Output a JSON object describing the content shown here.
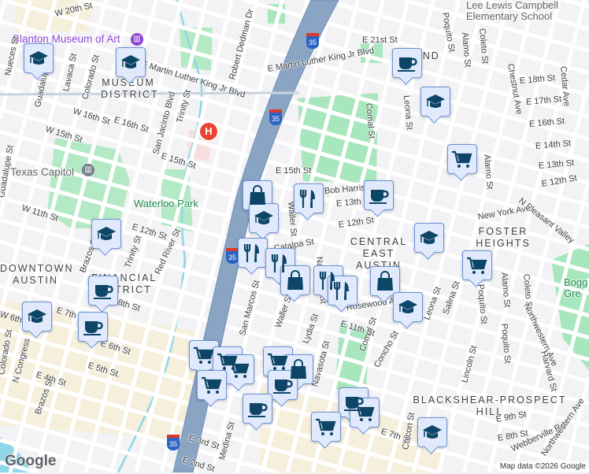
{
  "map": {
    "colors": {
      "background": "#f3f2f4",
      "road": "#ffffff",
      "road_edge": "#d3d9e0",
      "park": "#a8e6bd",
      "highway": "#8aa4c4",
      "water": "#8fd6e8",
      "marker_bg": "#e0eafc",
      "marker_border": "#6b93d6",
      "marker_icon": "#0d4566"
    },
    "pois": {
      "museum": "Blanton Museum of Art",
      "capitol": "Texas Capitol",
      "school": "Lee Lewis Campbell Elementary School",
      "park": "Waterloo Park",
      "boggy": "Bogg Gre",
      "hospital": "H"
    },
    "districts": {
      "museum": "MUSEUM DISTRICT",
      "downtown": "DOWNTOWN AUSTIN",
      "financial": "FINANCIAL DISTRICT",
      "central_east": "CENTRAL EAST AUSTIN",
      "foster": "FOSTER HEIGHTS",
      "blackshear": "BLACKSHEAR-PROSPECT HILL",
      "bland": "BLAND"
    },
    "streets": [
      "W 20th St",
      "E Martin Luther King Jr Blvd",
      "E Martin Luther King Jr Blvd",
      "Robert Dedman Dr",
      "Nueces St",
      "Guadalupe St",
      "Lavaca St",
      "Colorado St",
      "San Jacinto Blvd",
      "Trinity St",
      "W 16th St",
      "E 16th St",
      "W 15th St",
      "E 15th St",
      "E 15th St",
      "Guadalupe St",
      "W 11th St",
      "E 12th St",
      "E 12th St",
      "E 21st St",
      "Poquito St",
      "Alamo St",
      "Coleto St",
      "Comal St",
      "Leona St",
      "Chestnut Ave",
      "E 18th St",
      "E 17th St",
      "E 16th St",
      "E 14th St",
      "E 13th St",
      "Alamo St",
      "E 12th St",
      "Cedar Ave",
      "N Pleasant Valley",
      "New York Ave",
      "Bob Harrison",
      "E 13th St",
      "Waller St",
      "Catalpa St",
      "Red River St",
      "Brazos St",
      "Trinity St",
      "E 7th St",
      "E 8th St",
      "E 6th St",
      "E 5th St.",
      "E 4th St",
      "N Congress",
      "Brazos St",
      "Colorado St",
      "E 3rd St",
      "E 2nd St",
      "Medina St",
      "San Marcos St",
      "Waller St",
      "Navasota St",
      "Lydia St",
      "Navasota St",
      "Comal St",
      "Concho St",
      "Rosewood Ave",
      "E 11th St",
      "Leona St",
      "Salina St",
      "Poquito St",
      "Alamo St",
      "Coleto St",
      "Poquito St",
      "Northwestern Ave",
      "Harvard St",
      "Lincoln St",
      "E 9th St",
      "E 8th St",
      "Webberville Rd",
      "Northwestern Ave",
      "E 7th St",
      "Chicon St",
      "W 6th St"
    ],
    "highway_shield": "35",
    "markers": [
      {
        "icon": "school"
      },
      {
        "icon": "school"
      },
      {
        "icon": "coffee"
      },
      {
        "icon": "school"
      },
      {
        "icon": "cart"
      },
      {
        "icon": "shopping-bag"
      },
      {
        "icon": "school"
      },
      {
        "icon": "restaurant"
      },
      {
        "icon": "coffee"
      },
      {
        "icon": "school"
      },
      {
        "icon": "school"
      },
      {
        "icon": "restaurant"
      },
      {
        "icon": "restaurant"
      },
      {
        "icon": "shopping-bag"
      },
      {
        "icon": "restaurant"
      },
      {
        "icon": "restaurant"
      },
      {
        "icon": "shopping-bag"
      },
      {
        "icon": "cart"
      },
      {
        "icon": "school"
      },
      {
        "icon": "coffee"
      },
      {
        "icon": "school"
      },
      {
        "icon": "coffee"
      },
      {
        "icon": "cart"
      },
      {
        "icon": "cart"
      },
      {
        "icon": "cart"
      },
      {
        "icon": "cart"
      },
      {
        "icon": "cart"
      },
      {
        "icon": "shopping-bag"
      },
      {
        "icon": "coffee"
      },
      {
        "icon": "coffee"
      },
      {
        "icon": "coffee"
      },
      {
        "icon": "cart"
      },
      {
        "icon": "cart"
      },
      {
        "icon": "school"
      }
    ]
  },
  "footer": {
    "logo": "Google",
    "attribution": "Map data ©2026 Google"
  }
}
